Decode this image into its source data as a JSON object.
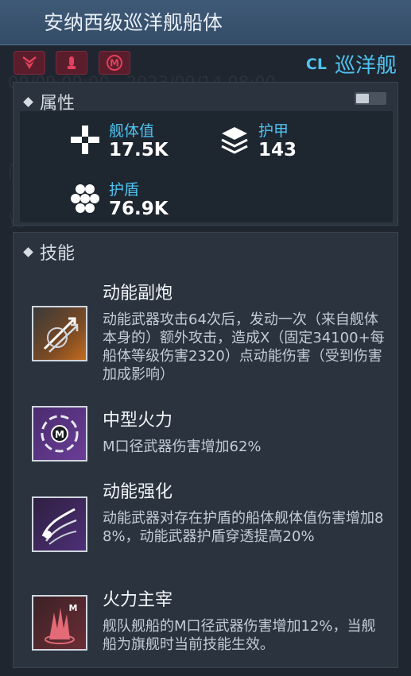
{
  "header": {
    "title": "安纳西级巡洋舰船体"
  },
  "badges": [
    {
      "icon": "shield-chevron-icon"
    },
    {
      "icon": "ammo-icon"
    },
    {
      "icon": "m-circle-icon"
    }
  ],
  "ship_type": {
    "code": "CL",
    "label": "巡洋舰"
  },
  "attributes": {
    "title": "属性",
    "stats": [
      {
        "label": "舰体值",
        "value": "17.5K",
        "icon": "hull-cross-icon"
      },
      {
        "label": "护甲",
        "value": "143",
        "icon": "armor-layers-icon"
      },
      {
        "label": "护盾",
        "value": "76.9K",
        "icon": "shield-hex-icon"
      }
    ]
  },
  "skills": {
    "title": "技能",
    "items": [
      {
        "name": "动能副炮",
        "desc": "动能武器攻击64次后，发动一次（来自舰体本身的）额外攻击，造成X（固定34100+每船体等级伤害2320）点动能伤害（受到伤害加成影响）"
      },
      {
        "name": "中型火力",
        "desc": "M口径武器伤害增加62%"
      },
      {
        "name": "动能强化",
        "desc": "动能武器对存在护盾的船体舰体值伤害增加88%，动能武器护盾穿透提高20%"
      },
      {
        "name": "火力主宰",
        "desc": "舰队舰船的M口径武器伤害增加12%，当舰船为旗舰时当前技能生效。"
      }
    ]
  },
  "colors": {
    "accent": "#4fc3f0",
    "titlebar": "#3f5a78",
    "panel": "#2a333e",
    "badge": "#5a1d2b"
  }
}
